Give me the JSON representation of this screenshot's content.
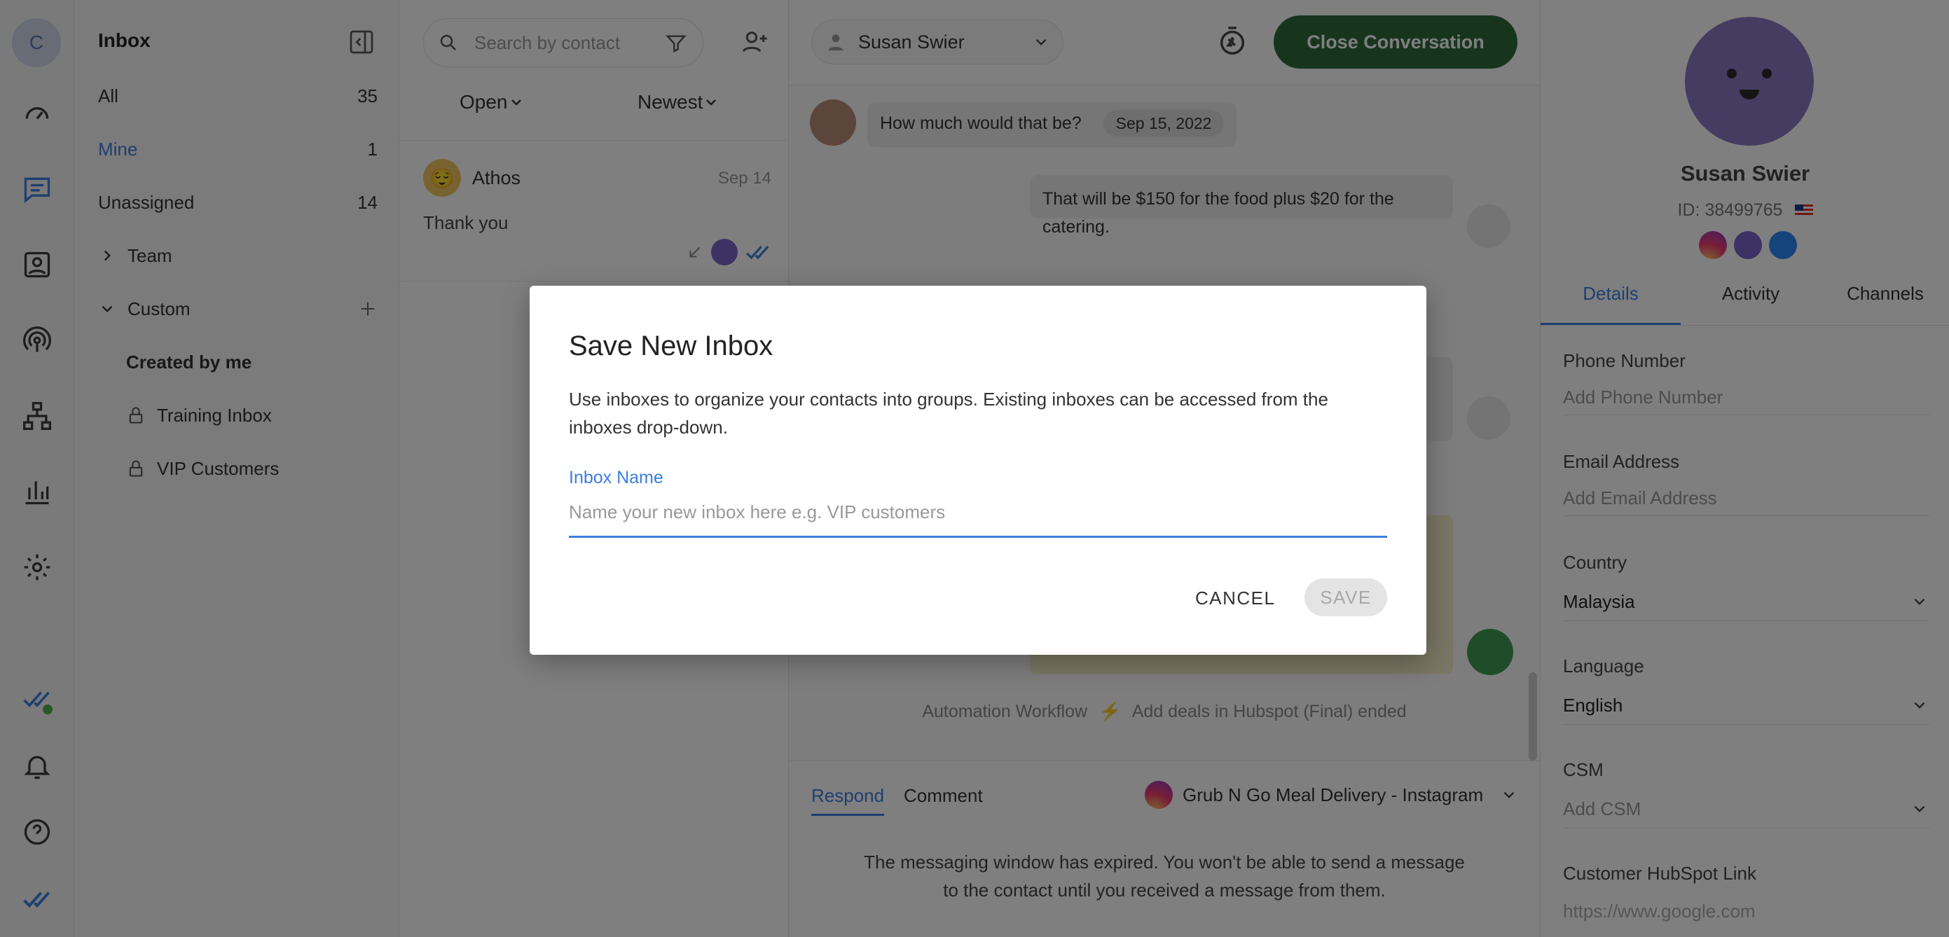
{
  "rail": {
    "avatar_letter": "C"
  },
  "nav": {
    "title": "Inbox",
    "items": [
      {
        "label": "All",
        "count": "35"
      },
      {
        "label": "Mine",
        "count": "1"
      },
      {
        "label": "Unassigned",
        "count": "14"
      }
    ],
    "team_label": "Team",
    "custom_label": "Custom",
    "created_by_me": "Created by me",
    "custom_inboxes": [
      {
        "label": "Training Inbox"
      },
      {
        "label": "VIP Customers"
      }
    ]
  },
  "list": {
    "search_placeholder": "Search by contact",
    "status_filter": "Open",
    "sort_filter": "Newest",
    "conversations": [
      {
        "name": "Athos",
        "date": "Sep 14",
        "preview": "Thank you"
      }
    ]
  },
  "chat": {
    "assignee": "Susan Swier",
    "close_button": "Close Conversation",
    "messages": [
      {
        "text": "How much would that be?",
        "date": "Sep 15, 2022"
      },
      {
        "text": "That will be $150 for the food plus $20 for the catering."
      }
    ],
    "automation_label": "Automation Workflow",
    "automation_text": "Add deals in Hubspot (Final) ended",
    "tab_respond": "Respond",
    "tab_comment": "Comment",
    "channel": "Grub N Go Meal Delivery - Instagram",
    "expired_notice": "The messaging window has expired. You won't be able to send a message to the contact until you received a message from them."
  },
  "contact": {
    "name": "Susan Swier",
    "id": "ID: 38499765",
    "tabs": [
      "Details",
      "Activity",
      "Channels"
    ],
    "fields": [
      {
        "label": "Phone Number",
        "value": "Add Phone Number"
      },
      {
        "label": "Email Address",
        "value": "Add Email Address"
      },
      {
        "label": "Country",
        "value": "Malaysia"
      },
      {
        "label": "Language",
        "value": "English"
      },
      {
        "label": "CSM",
        "value": "Add CSM"
      },
      {
        "label": "Customer HubSpot Link",
        "value": "https://www.google.com"
      }
    ]
  },
  "dialog": {
    "title": "Save New Inbox",
    "description": "Use inboxes to organize your contacts into groups. Existing inboxes can be accessed from the inboxes drop-down.",
    "field_label": "Inbox Name",
    "field_placeholder": "Name your new inbox here e.g. VIP customers",
    "cancel": "CANCEL",
    "save": "SAVE"
  },
  "colors": {
    "accent": "#3d7ee0",
    "close_button": "#2f6b3a",
    "avatar": "#8b78c4"
  }
}
